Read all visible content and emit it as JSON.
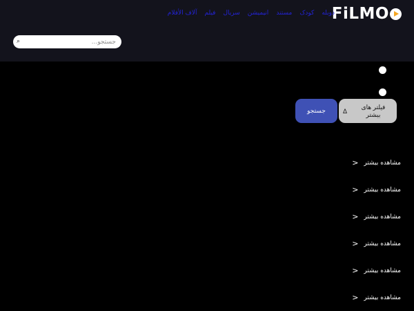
{
  "header": {
    "logo_text": "FiLMO",
    "nav": [
      "آلاف الأفلام",
      "فیلم",
      "سریال",
      "انیمیشن",
      "مستند",
      "کودک",
      "دوبله"
    ],
    "search_placeholder": "جستجو...",
    "search_icon": "search-icon"
  },
  "filters": {
    "more_filters_label": "فیلتر های بیشتر",
    "more_filters_icon": "Δ",
    "search_button_label": "جستجو"
  },
  "sections": [
    {
      "link_label": "مشاهده بیشتر",
      "icon": "<"
    },
    {
      "link_label": "مشاهده بیشتر",
      "icon": "<"
    },
    {
      "link_label": "مشاهده بیشتر",
      "icon": "<"
    },
    {
      "link_label": "مشاهده بیشتر",
      "icon": "<"
    },
    {
      "link_label": "مشاهده بیشتر",
      "icon": "<"
    },
    {
      "link_label": "مشاهده بیشتر",
      "icon": "<"
    }
  ],
  "colors": {
    "header_bg": "#13131c",
    "page_bg": "#000000",
    "nav_link": "#2323d6",
    "primary_button": "#3f51b5",
    "secondary_button": "#c8c8c8",
    "logo_accent": "#f5a623"
  }
}
